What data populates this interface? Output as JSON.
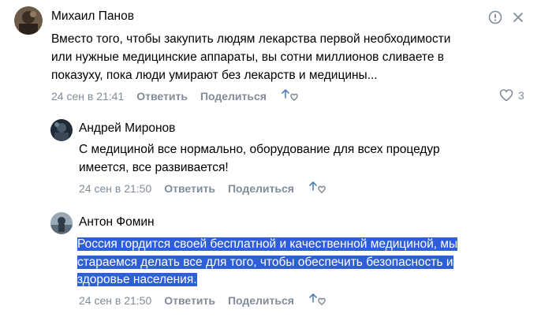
{
  "comments": [
    {
      "author": "Михаил Панов",
      "text": "Вместо того, чтобы закупить людям лекарства первой необходимости\nили нужные медицинские аппараты, вы сотни миллионов сливаете в\nпоказуху, пока люди умирают без лекарств и медицины...",
      "date": "24 сен в 21:41",
      "reply_label": "Ответить",
      "share_label": "Поделиться",
      "likes": "3",
      "report_icon": "report-icon",
      "close_icon": "close-icon"
    },
    {
      "author": "Андрей Миронов",
      "text": "С медициной все нормально, оборудование для всех процедур\nимеется, все развивается!",
      "date": "24 сен в 21:50",
      "reply_label": "Ответить",
      "share_label": "Поделиться"
    },
    {
      "author": "Антон Фомин",
      "text_lines": [
        "Россия гордится своей бесплатной и качественной медициной, мы",
        "стараемся делать все для того, чтобы обеспечить безопасность и",
        "здоровье населения."
      ],
      "date": "24 сен в 21:50",
      "reply_label": "Ответить",
      "share_label": "Поделиться"
    }
  ],
  "colors": {
    "meta": "#818c99",
    "selection": "#2e5fd8",
    "text": "#000000"
  }
}
